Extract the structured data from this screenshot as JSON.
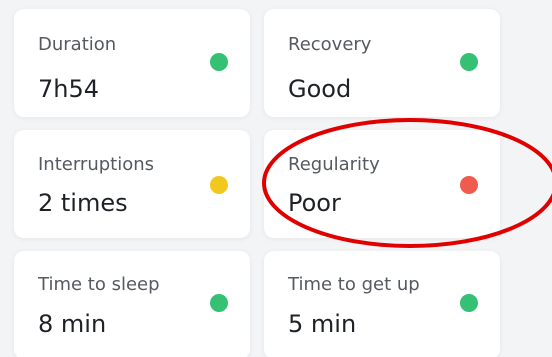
{
  "cards": [
    {
      "label": "Duration",
      "value": "7h54",
      "status_color": "#34c174"
    },
    {
      "label": "Recovery",
      "value": "Good",
      "status_color": "#34c174"
    },
    {
      "label": "Interruptions",
      "value": "2 times",
      "status_color": "#f2c81f"
    },
    {
      "label": "Regularity",
      "value": "Poor",
      "status_color": "#ef5b4c"
    },
    {
      "label": "Time to sleep",
      "value": "8 min",
      "status_color": "#34c174"
    },
    {
      "label": "Time to get up",
      "value": "5 min",
      "status_color": "#34c174"
    }
  ],
  "annotation": {
    "shape": "ellipse",
    "color": "#e00000",
    "target": "Regularity"
  }
}
